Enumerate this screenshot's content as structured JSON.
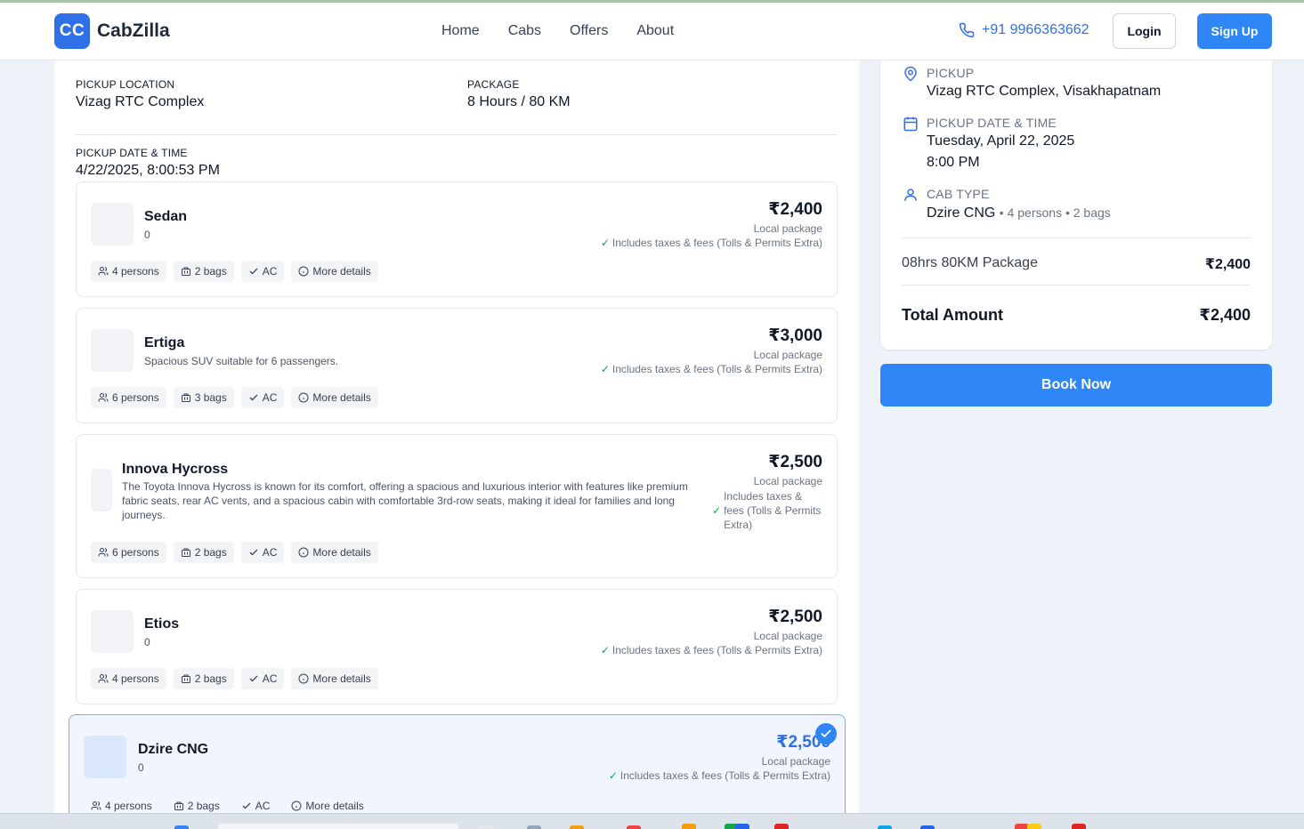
{
  "brand": {
    "logo": "CC",
    "name": "CabZilla",
    "accent": "#2f86f6"
  },
  "nav": [
    "Home",
    "Cabs",
    "Offers",
    "About"
  ],
  "header": {
    "phone": "+91 9966363662",
    "login": "Login",
    "signup": "Sign Up"
  },
  "trip": {
    "pickup_label": "PICKUP LOCATION",
    "pickup_value": "Vizag RTC Complex",
    "package_label": "PACKAGE",
    "package_value": "8 Hours / 80 KM",
    "datetime_label": "PICKUP DATE & TIME",
    "datetime_value": "4/22/2025, 8:00:53 PM"
  },
  "cabs": [
    {
      "name": "Sedan",
      "desc": "0",
      "price": "₹2,400",
      "package": "Local package",
      "includes": "Includes taxes & fees (Tolls & Permits Extra)",
      "persons": "4 persons",
      "bags": "2 bags",
      "ac": "AC",
      "more": "More details",
      "selected": false
    },
    {
      "name": "Ertiga",
      "desc": "Spacious SUV suitable for 6 passengers.",
      "price": "₹3,000",
      "package": "Local package",
      "includes": "Includes taxes & fees (Tolls & Permits Extra)",
      "persons": "6 persons",
      "bags": "3 bags",
      "ac": "AC",
      "more": "More details",
      "selected": false
    },
    {
      "name": "Innova Hycross",
      "desc": "The Toyota Innova Hycross is known for its comfort, offering a spacious and luxurious interior with features like premium fabric seats, rear AC vents, and a spacious cabin with comfortable 3rd-row seats, making it ideal for families and long journeys.",
      "price": "₹2,500",
      "package": "Local package",
      "includes": "Includes taxes & fees (Tolls & Permits Extra)",
      "persons": "6 persons",
      "bags": "2 bags",
      "ac": "AC",
      "more": "More details",
      "selected": false
    },
    {
      "name": "Etios",
      "desc": "0",
      "price": "₹2,500",
      "package": "Local package",
      "includes": "Includes taxes & fees (Tolls & Permits Extra)",
      "persons": "4 persons",
      "bags": "2 bags",
      "ac": "AC",
      "more": "More details",
      "selected": false
    },
    {
      "name": "Dzire CNG",
      "desc": "0",
      "price": "₹2,500",
      "package": "Local package",
      "includes": "Includes taxes & fees (Tolls & Permits Extra)",
      "persons": "4 persons",
      "bags": "2 bags",
      "ac": "AC",
      "more": "More details",
      "selected": true
    }
  ],
  "summary": {
    "pickup_label": "PICKUP",
    "pickup_value": "Vizag RTC Complex, Visakhapatnam",
    "datetime_label": "PICKUP DATE & TIME",
    "date_value": "Tuesday, April 22, 2025",
    "time_value": "8:00 PM",
    "cab_label": "CAB TYPE",
    "cab_value": "Dzire CNG",
    "cab_meta": "• 4 persons • 2 bags",
    "package_line": "08hrs 80KM Package",
    "package_price": "₹2,400",
    "total_label": "Total Amount",
    "total_value": "₹2,400",
    "book": "Book Now"
  }
}
